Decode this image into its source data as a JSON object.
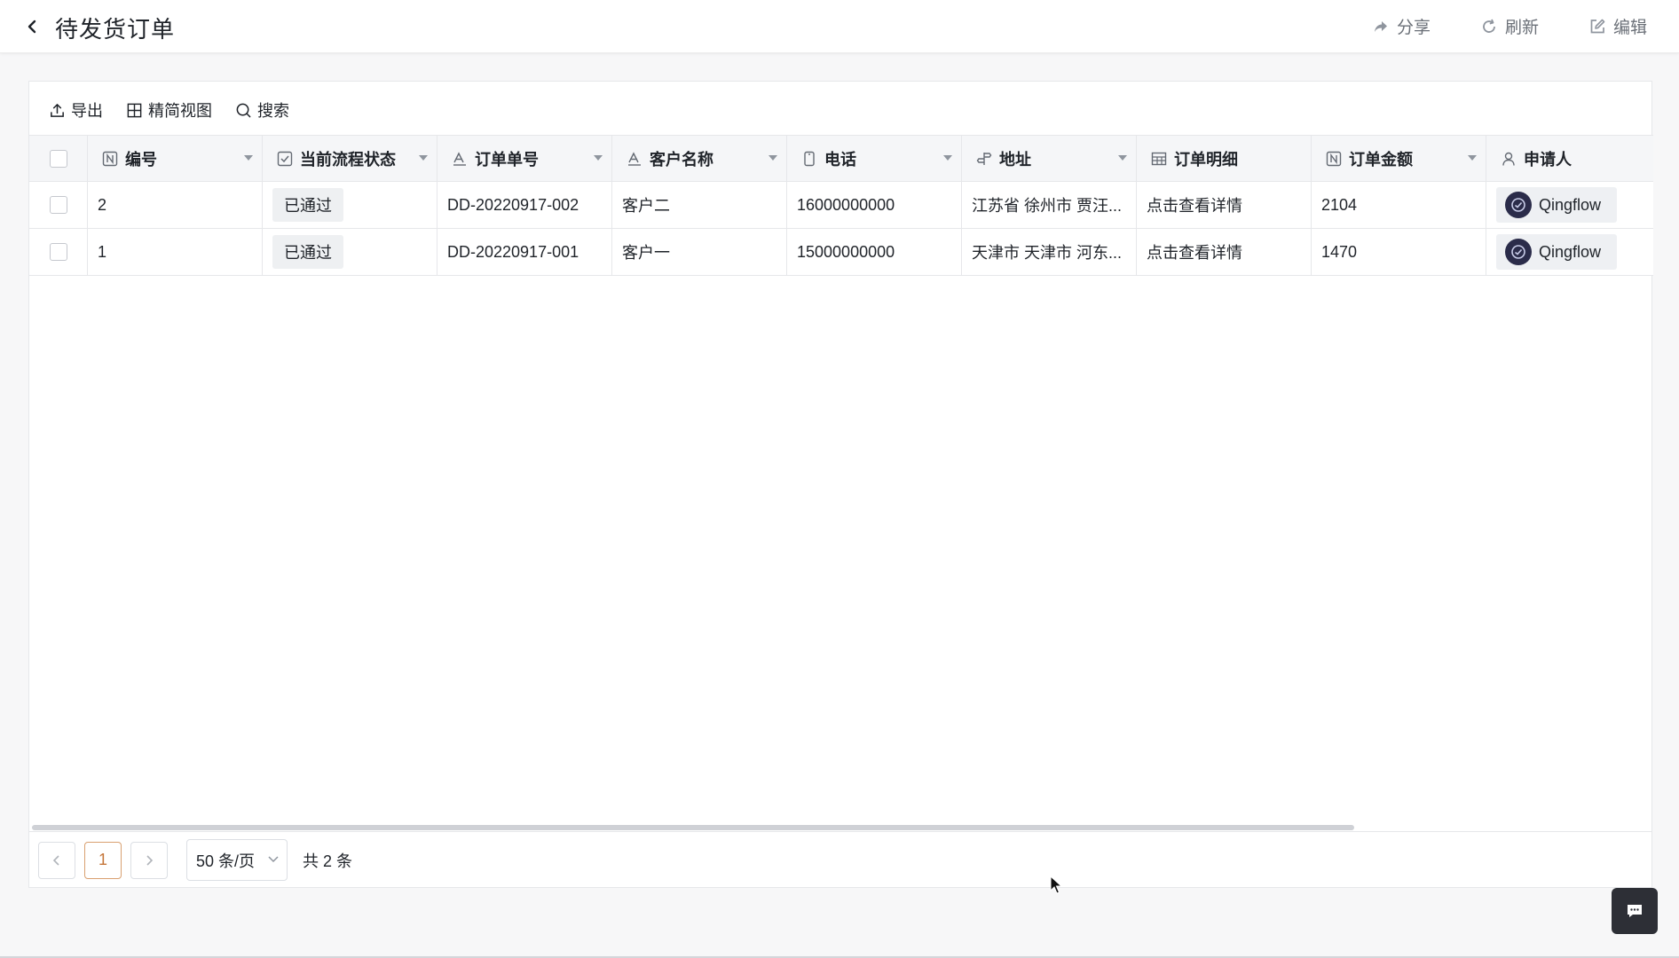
{
  "header": {
    "title": "待发货订单",
    "actions": {
      "share": "分享",
      "refresh": "刷新",
      "edit": "编辑"
    }
  },
  "toolbar": {
    "export": "导出",
    "compact_view": "精简视图",
    "search": "搜索"
  },
  "table": {
    "columns": [
      {
        "label": "编号",
        "icon": "number-field-icon"
      },
      {
        "label": "当前流程状态",
        "icon": "checkbox-field-icon"
      },
      {
        "label": "订单单号",
        "icon": "text-field-icon"
      },
      {
        "label": "客户名称",
        "icon": "text-field-icon"
      },
      {
        "label": "电话",
        "icon": "phone-field-icon"
      },
      {
        "label": "地址",
        "icon": "address-field-icon"
      },
      {
        "label": "订单明细",
        "icon": "table-field-icon"
      },
      {
        "label": "订单金额",
        "icon": "number-field-icon"
      },
      {
        "label": "申请人",
        "icon": "person-field-icon"
      }
    ],
    "rows": [
      {
        "id": "2",
        "status": "已通过",
        "order_no": "DD-20220917-002",
        "customer": "客户二",
        "phone": "16000000000",
        "address": "江苏省 徐州市 贾汪...",
        "detail": "点击查看详情",
        "amount": "2104",
        "applicant": "Qingflow"
      },
      {
        "id": "1",
        "status": "已通过",
        "order_no": "DD-20220917-001",
        "customer": "客户一",
        "phone": "15000000000",
        "address": "天津市 天津市 河东...",
        "detail": "点击查看详情",
        "amount": "1470",
        "applicant": "Qingflow"
      }
    ]
  },
  "pagination": {
    "current_page": "1",
    "page_size": "50 条/页",
    "total": "共 2 条"
  },
  "colors": {
    "accent_page": "#c5763a",
    "chat_button": "#2d2f36",
    "avatar": "#2b2c4a"
  }
}
